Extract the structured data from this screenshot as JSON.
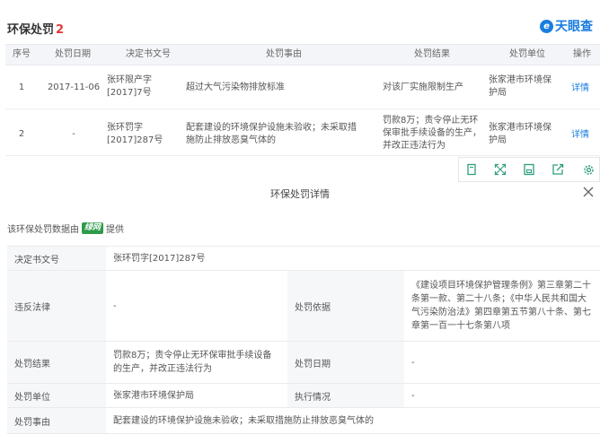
{
  "header": {
    "title": "环保处罚",
    "count": "2",
    "brand": "天眼查",
    "brand_mark": "e"
  },
  "table": {
    "columns": [
      "序号",
      "处罚日期",
      "决定书文号",
      "处罚事由",
      "处罚结果",
      "处罚单位",
      "操作"
    ],
    "rows": [
      {
        "index": "1",
        "date": "2017-11-06",
        "doc_no": "张环限产字[2017]7号",
        "reason": "超过大气污染物排放标准",
        "result": "对该厂实施限制生产",
        "unit": "张家港市环境保护局",
        "action": "详情"
      },
      {
        "index": "2",
        "date": "-",
        "doc_no": "张环罚字[2017]287号",
        "reason": "配套建设的环境保护设施未验收；未采取措施防止排放恶臭气体的",
        "result": "罚款8万；责令停止无环保审批手续设备的生产，并改正违法行为",
        "unit": "张家港市环境保护局",
        "action": "详情"
      }
    ]
  },
  "toolbar": {
    "icons": [
      "copy-icon",
      "expand-icon",
      "save-icon",
      "share-icon",
      "settings-icon"
    ]
  },
  "detail": {
    "title": "环保处罚详情",
    "source_prefix": "该环保处罚数据由",
    "source_brand": "绿网",
    "source_suffix": "提供",
    "fields": {
      "doc_no_label": "决定书文号",
      "doc_no": "张环罚字[2017]287号",
      "law_label": "违反法律",
      "law": "-",
      "basis_label": "处罚依据",
      "basis": "《建设项目环境保护管理条例》第三章第二十条第一款、第二十八条；《中华人民共和国大气污染防治法》第四章第五节第八十条、第七章第一百一十七条第八项",
      "result_label": "处罚结果",
      "result": "罚款8万；责令停止无环保审批手续设备的生产，并改正违法行为",
      "date_label": "处罚日期",
      "date": "-",
      "unit_label": "处罚单位",
      "unit": "张家港市环境保护局",
      "status_label": "执行情况",
      "status": "-",
      "reason_label": "处罚事由",
      "reason": "配套建设的环境保护设施未验收；未采取措施防止排放恶臭气体的"
    }
  },
  "colors": {
    "accent": "#1a7de0",
    "count": "#e4393c",
    "source_brand": "#2e9b4b"
  }
}
